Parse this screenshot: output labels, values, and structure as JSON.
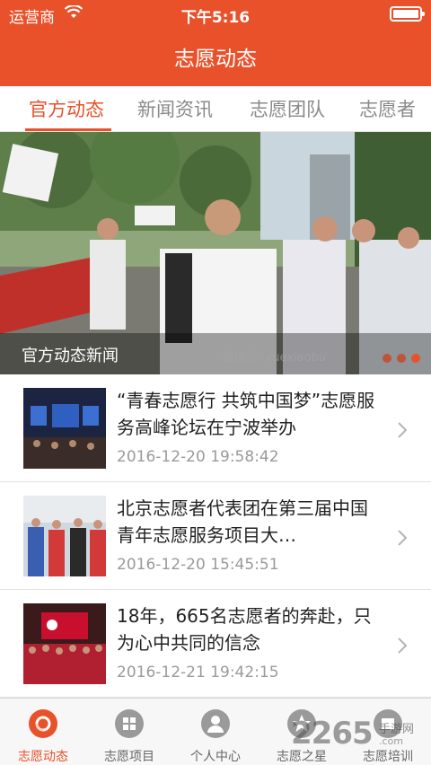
{
  "status_bar": {
    "carrier": "运营商",
    "time": "下午5:16"
  },
  "header": {
    "title": "志愿动态"
  },
  "tabs": [
    {
      "label": "官方动态",
      "active": true
    },
    {
      "label": "新闻资讯",
      "active": false
    },
    {
      "label": "志愿团队",
      "active": false
    },
    {
      "label": "志愿者",
      "active": false
    }
  ],
  "banner": {
    "caption": "官方动态新闻",
    "watermark": "微信号: xuexiaobu",
    "dots_count": 3,
    "active_dot": 3
  },
  "news": [
    {
      "title": "“青春志愿行 共筑中国梦”志愿服务高峰论坛在宁波举办",
      "date": "2016-12-20 19:58:42"
    },
    {
      "title": "北京志愿者代表团在第三届中国青年志愿服务项目大…",
      "date": "2016-12-20 15:45:51"
    },
    {
      "title": "18年，665名志愿者的奔赴，只为心中共同的信念",
      "date": "2016-12-21 19:42:15"
    }
  ],
  "bottom_nav": [
    {
      "label": "志愿动态",
      "icon": "refresh-circle-icon",
      "active": true
    },
    {
      "label": "志愿项目",
      "icon": "grid-icon",
      "active": false
    },
    {
      "label": "个人中心",
      "icon": "person-icon",
      "active": false
    },
    {
      "label": "志愿之星",
      "icon": "star-icon",
      "active": false
    },
    {
      "label": "志愿培训",
      "icon": "training-icon",
      "active": false
    }
  ],
  "brand_watermark": {
    "number": "2265",
    "sub": "手游网",
    "url": ".com"
  },
  "colors": {
    "accent": "#e8512a",
    "inactive": "#8a8a8a"
  }
}
